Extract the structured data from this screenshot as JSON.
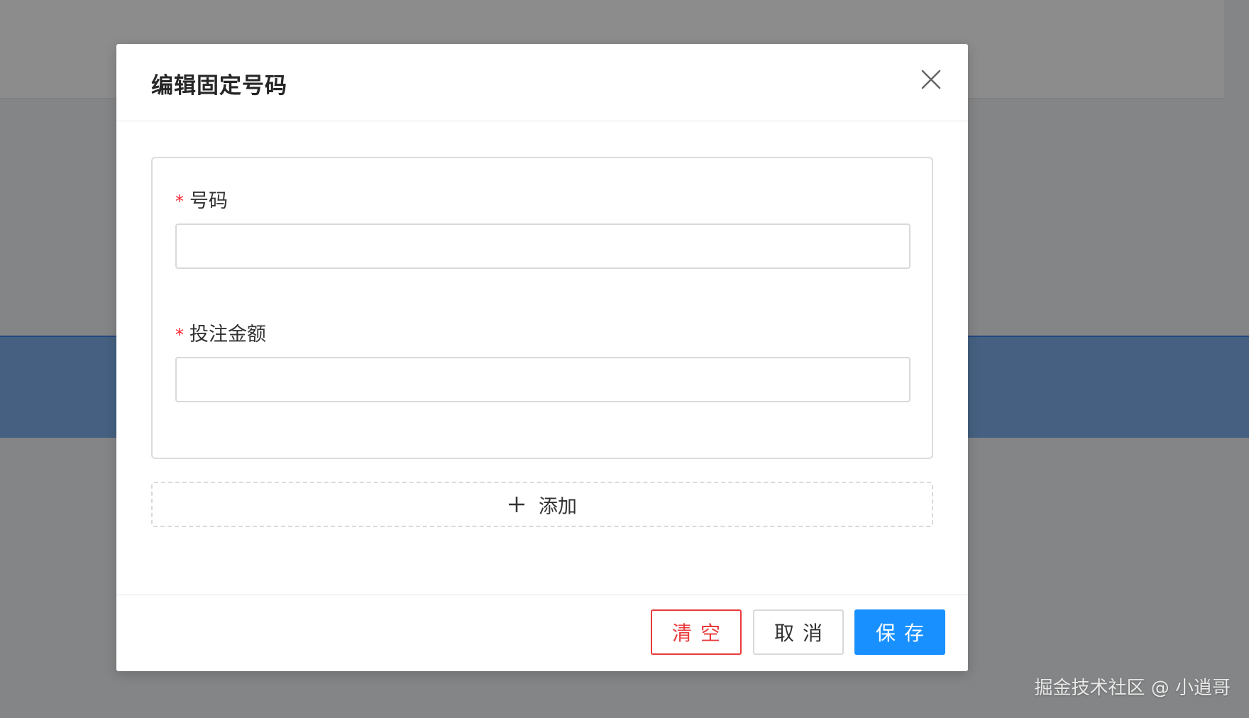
{
  "modal": {
    "title": "编辑固定号码",
    "close_icon": "close-icon"
  },
  "form": {
    "fields": [
      {
        "label": "号码",
        "required_mark": "*",
        "value": "",
        "placeholder": ""
      },
      {
        "label": "投注金额",
        "required_mark": "*",
        "value": "",
        "placeholder": ""
      }
    ]
  },
  "add_button": {
    "icon": "plus-icon",
    "label": "添加"
  },
  "footer": {
    "clear_label": "清空",
    "cancel_label": "取消",
    "save_label": "保存"
  },
  "watermark": "掘金技术社区 @ 小逍哥",
  "colors": {
    "primary": "#1890ff",
    "danger": "#e83a3a",
    "required": "#f5222d"
  }
}
